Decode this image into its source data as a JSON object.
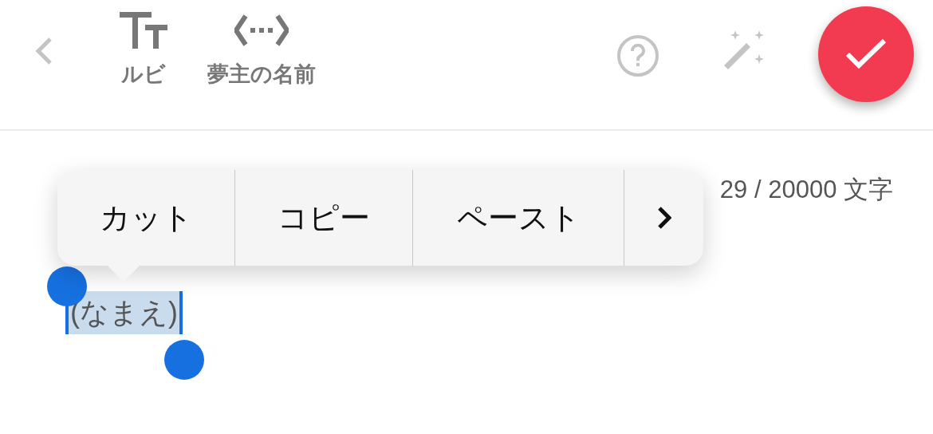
{
  "toolbar": {
    "items": [
      {
        "kind": "ruby",
        "label": "ルビ"
      },
      {
        "kind": "name",
        "label": "夢主の名前"
      }
    ]
  },
  "counter": "29 / 20000 文字",
  "editor": {
    "selected_text": "(なまえ)"
  },
  "context_menu": {
    "items": [
      "カット",
      "コピー",
      "ペースト"
    ]
  }
}
